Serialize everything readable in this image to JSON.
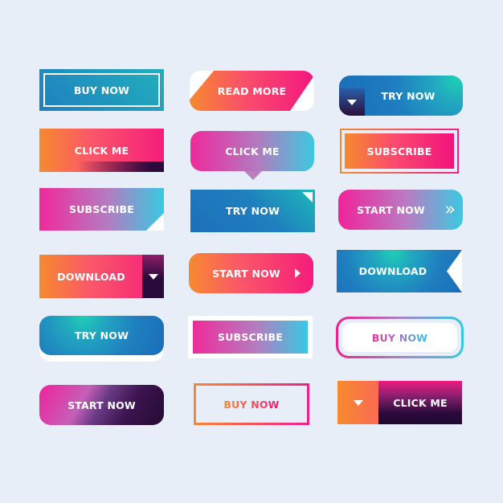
{
  "background_color": "#e8eef8",
  "buttons": [
    {
      "label": "BUY NOW",
      "style": "teal-blue gradient, square, inner white frame"
    },
    {
      "label": "READ MORE",
      "style": "orange-pink gradient, slanted parallelogram on white rounded base"
    },
    {
      "label": "TRY NOW",
      "style": "blue-teal gradient, rounded, dropdown corner"
    },
    {
      "label": "CLICK ME",
      "style": "orange-pink gradient, square, dark bottom bar"
    },
    {
      "label": "CLICK ME",
      "style": "pink-purple-cyan gradient, rounded, speech tail"
    },
    {
      "label": "SUBSCRIBE",
      "style": "orange-pink gradient, double gradient frame"
    },
    {
      "label": "SUBSCRIBE",
      "style": "pink-cyan gradient, square, cut corner bottom-right"
    },
    {
      "label": "TRY NOW",
      "style": "blue-teal gradient, square, folded corner top-right"
    },
    {
      "label": "START NOW",
      "style": "pink-cyan gradient, rounded, double chevron",
      "icon": "double-chevron-right-icon",
      "icon_glyph": "»"
    },
    {
      "label": "DOWNLOAD",
      "style": "orange-pink gradient, square, dark dropdown segment",
      "icon": "caret-down-icon"
    },
    {
      "label": "START NOW",
      "style": "orange-pink gradient, rounded, play arrow",
      "icon": "play-arrow-icon"
    },
    {
      "label": "DOWNLOAD",
      "style": "blue-teal gradient, ribbon notch right"
    },
    {
      "label": "TRY NOW",
      "style": "blue-teal gradient, rounded, white drop shadow"
    },
    {
      "label": "SUBSCRIBE",
      "style": "pink-cyan gradient, white frame"
    },
    {
      "label": "BUY NOW",
      "style": "white fill, gradient rounded outline, gradient text"
    },
    {
      "label": "START NOW",
      "style": "pink to dark-purple diagonal gradient, rounded"
    },
    {
      "label": "BUY NOW",
      "style": "transparent, orange-pink gradient outline, gradient text"
    },
    {
      "label": "CLICK ME",
      "style": "orange caret segment + pink-dark gradient",
      "icon": "caret-down-icon"
    }
  ],
  "colors": {
    "orange": "#f68a2e",
    "pink": "#f2177f",
    "magenta": "#ef2a9a",
    "cyan": "#38c9e2",
    "blue": "#1f7fbf",
    "teal": "#1ecfb4",
    "dark_purple": "#2a0a3a"
  }
}
